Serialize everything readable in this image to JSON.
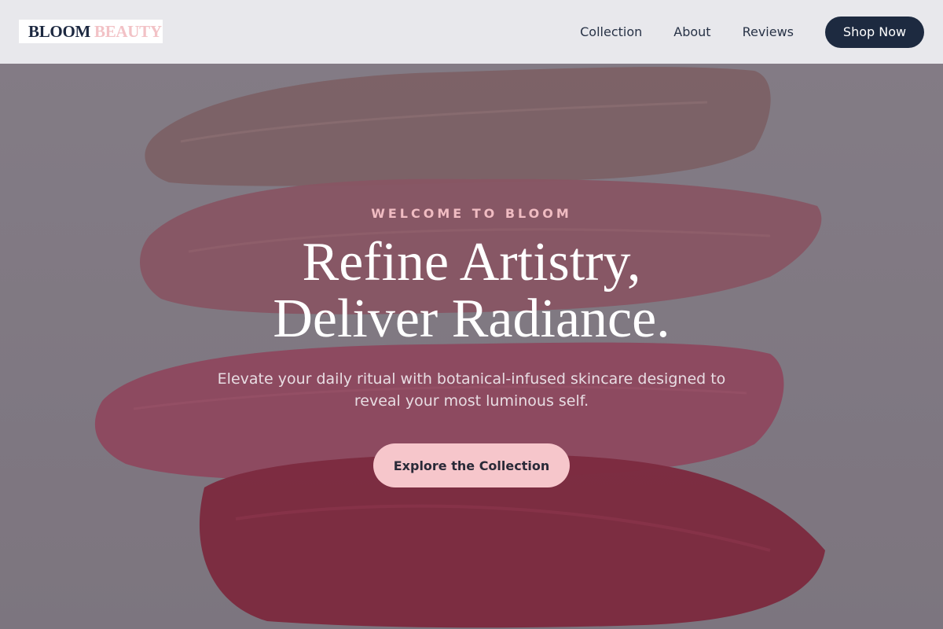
{
  "brand": {
    "name_primary": "BLOOM",
    "name_secondary": "BEAUTY"
  },
  "nav": {
    "links": [
      "Collection",
      "About",
      "Reviews"
    ],
    "cta_label": "Shop Now"
  },
  "hero": {
    "eyebrow": "WELCOME TO BLOOM",
    "headline_line1": "Refine Artistry,",
    "headline_line2": "Deliver Radiance.",
    "subtext": "Elevate your daily ritual with botanical-infused skincare designed to reveal your most luminous self.",
    "cta_label": "Explore the Collection"
  },
  "colors": {
    "nav_bg": "#ececf0",
    "brand_dark": "#1d2a40",
    "brand_pink": "#f2c2c6",
    "swatch_1": "#8b6a6a",
    "swatch_2": "#9c5a66",
    "swatch_3": "#a04a62",
    "swatch_4": "#8a1f33"
  }
}
